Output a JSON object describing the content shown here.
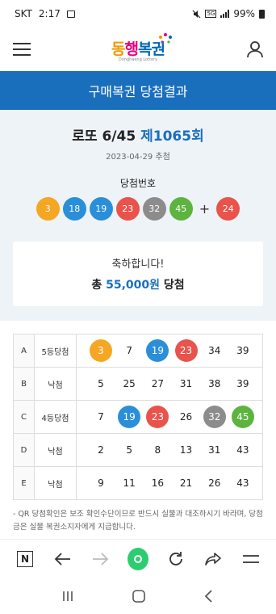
{
  "status": {
    "carrier": "SKT",
    "time": "2:17",
    "battery": "99%",
    "network": "5G"
  },
  "header": {
    "logo_text_a": "동",
    "logo_text_b": "행",
    "logo_text_c": "복권",
    "logo_sub": "Donghaeng Lottery"
  },
  "title": "구매복권 당첨결과",
  "draw": {
    "game": "로또 6/45",
    "round": "제1065회",
    "date": "2023-04-29 추첨",
    "win_label": "당첨번호",
    "numbers": [
      "3",
      "18",
      "19",
      "23",
      "32",
      "45"
    ],
    "plus": "+",
    "bonus": "24"
  },
  "congrats": {
    "message": "축하합니다!",
    "prefix": "총",
    "amount": "55,000원",
    "suffix": "당첨"
  },
  "tickets": [
    {
      "game": "A",
      "result": "5등당첨",
      "numbers": [
        "3",
        "7",
        "19",
        "23",
        "34",
        "39"
      ]
    },
    {
      "game": "B",
      "result": "낙첨",
      "numbers": [
        "5",
        "25",
        "27",
        "31",
        "38",
        "39"
      ]
    },
    {
      "game": "C",
      "result": "4등당첨",
      "numbers": [
        "7",
        "19",
        "23",
        "26",
        "32",
        "45"
      ]
    },
    {
      "game": "D",
      "result": "낙첨",
      "numbers": [
        "2",
        "5",
        "8",
        "13",
        "31",
        "43"
      ]
    },
    {
      "game": "E",
      "result": "낙첨",
      "numbers": [
        "9",
        "11",
        "16",
        "21",
        "26",
        "43"
      ]
    }
  ],
  "notice": "- QR 당첨확인은 보조 확인수단이므로 반드시 실물과 대조하시기 바라며, 당첨금은 실물 복권소지자에게 지급합니다.",
  "colors": {
    "primary": "#1a6fbd",
    "yellow": "#f5a623",
    "blue": "#2a8fd8",
    "red": "#e8534c",
    "gray": "#8c8c8c",
    "green": "#5cb43f"
  },
  "browser": {
    "n_label": "N"
  }
}
